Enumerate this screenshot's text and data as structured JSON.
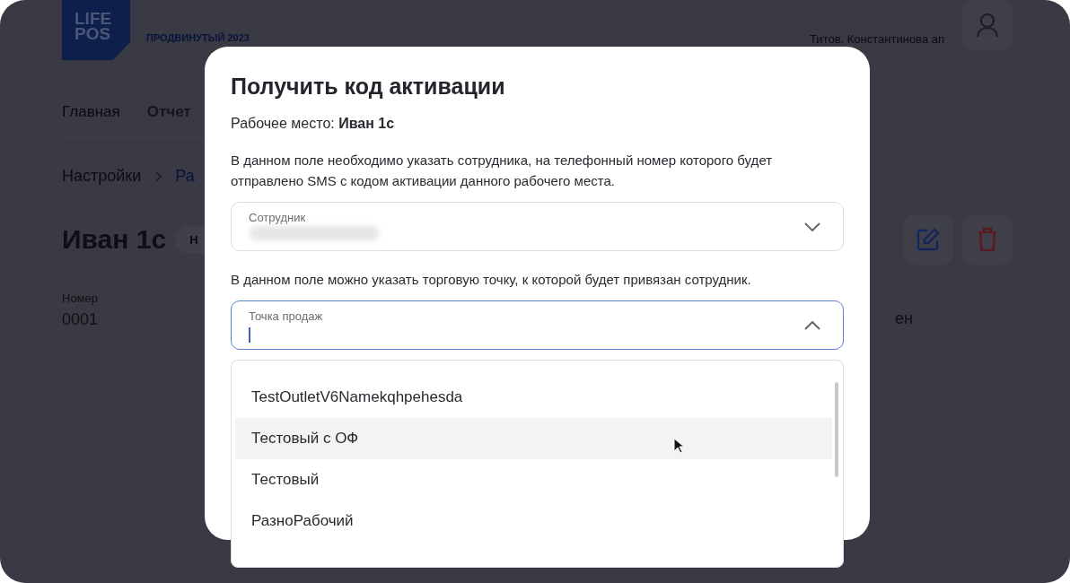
{
  "background_page": {
    "logo": [
      "LIFE",
      "POS"
    ],
    "plan": "ПРОДВИНУТЫЙ 2023",
    "user_name": "Титов. Константинова ап",
    "nav": [
      {
        "label": "Главная",
        "selected": false
      },
      {
        "label": "Отчет",
        "selected": true
      }
    ],
    "breadcrumbs": [
      "Настройки",
      "Ра"
    ],
    "title": "Иван 1с",
    "status_badge": "Н",
    "info": {
      "label": "Номер",
      "value": "0001"
    },
    "info_fragment": "ен"
  },
  "modal": {
    "title": "Получить код активации",
    "workplace_label": "Рабочее место:",
    "workplace_value": "Иван 1с",
    "employee_hint": "В данном поле необходимо указать сотрудника, на телефонный номер которого будет отправлено SMS с кодом активации данного рабочего места.",
    "employee_field": {
      "label": "Сотрудник",
      "expanded": false
    },
    "outlet_hint": "В данном поле можно указать торговую точку, к которой будет привязан сотрудник.",
    "outlet_field": {
      "label": "Точка продаж",
      "expanded": true
    },
    "options": [
      {
        "label": "TestOutletV6Namekqhpehesda",
        "hovered": false
      },
      {
        "label": "Тестовый с ОФ",
        "hovered": true
      },
      {
        "label": "Тестовый",
        "hovered": false
      },
      {
        "label": "РазноРабочий",
        "hovered": false
      }
    ]
  }
}
